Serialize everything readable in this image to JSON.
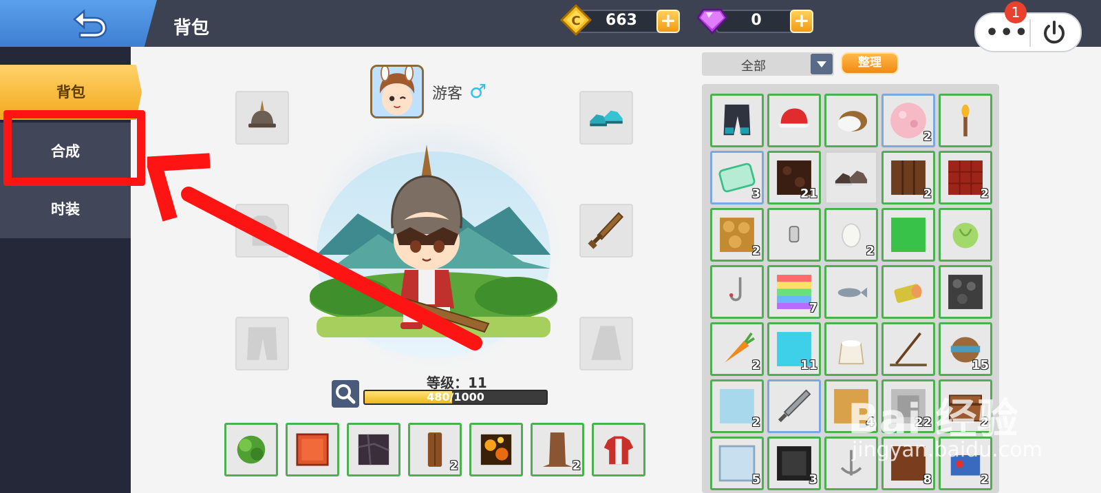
{
  "header": {
    "title": "背包",
    "coins": "663",
    "gems": "0",
    "notification_count": "1",
    "menu_label": "•••"
  },
  "sidebar": {
    "items": [
      {
        "label": "背包"
      },
      {
        "label": "合成"
      },
      {
        "label": "时装"
      }
    ]
  },
  "player": {
    "name": "游客",
    "gender_symbol": "♂",
    "level_text": "等级：11",
    "xp_text": "480/1000",
    "xp_fraction": 0.48
  },
  "inventory": {
    "filter_label": "全部",
    "sort_label": "整理"
  },
  "hotbar": [
    {
      "icon": "leaf-block-icon",
      "count": ""
    },
    {
      "icon": "red-brick-icon",
      "count": ""
    },
    {
      "icon": "dark-stone-icon",
      "count": ""
    },
    {
      "icon": "log-icon",
      "count": "2"
    },
    {
      "icon": "lava-block-icon",
      "count": ""
    },
    {
      "icon": "tree-trunk-icon",
      "count": "2"
    },
    {
      "icon": "red-shirt-icon",
      "count": ""
    }
  ],
  "inventory_items": [
    {
      "icon": "pants-icon",
      "count": ""
    },
    {
      "icon": "red-cap-icon",
      "count": ""
    },
    {
      "icon": "coconut-icon",
      "count": ""
    },
    {
      "icon": "pink-flower-block-icon",
      "count": "2"
    },
    {
      "icon": "torch-icon",
      "count": ""
    },
    {
      "icon": "ticket-icon",
      "count": "3"
    },
    {
      "icon": "dark-soil-icon",
      "count": "21"
    },
    {
      "icon": "shoes-icon",
      "count": ""
    },
    {
      "icon": "wood-plank-icon",
      "count": "2"
    },
    {
      "icon": "red-pattern-block-icon",
      "count": "2"
    },
    {
      "icon": "sandstone-icon",
      "count": "2"
    },
    {
      "icon": "lamp-icon",
      "count": ""
    },
    {
      "icon": "egg-icon",
      "count": "2"
    },
    {
      "icon": "grass-block-icon",
      "count": ""
    },
    {
      "icon": "cabbage-icon",
      "count": ""
    },
    {
      "icon": "fish-hook-icon",
      "count": ""
    },
    {
      "icon": "rainbow-block-icon",
      "count": "7"
    },
    {
      "icon": "fish-icon",
      "count": ""
    },
    {
      "icon": "log-slice-icon",
      "count": ""
    },
    {
      "icon": "gravel-icon",
      "count": ""
    },
    {
      "icon": "carrot-icon",
      "count": "2"
    },
    {
      "icon": "water-block-icon",
      "count": "11"
    },
    {
      "icon": "flour-sack-icon",
      "count": ""
    },
    {
      "icon": "fishing-rod-icon",
      "count": ""
    },
    {
      "icon": "barrel-icon",
      "count": "15"
    },
    {
      "icon": "ice-block-icon",
      "count": "2"
    },
    {
      "icon": "dagger-icon",
      "count": ""
    },
    {
      "icon": "sand-block-icon",
      "count": "4"
    },
    {
      "icon": "stone-slab-icon",
      "count": "22"
    },
    {
      "icon": "chest-icon",
      "count": "2"
    },
    {
      "icon": "glass-block-icon",
      "count": "5"
    },
    {
      "icon": "obsidian-icon",
      "count": "3"
    },
    {
      "icon": "anchor-icon",
      "count": ""
    },
    {
      "icon": "wood-block-icon",
      "count": "8"
    },
    {
      "icon": "toolkit-icon",
      "count": "2"
    }
  ],
  "watermark": {
    "text": "Bai 经验",
    "sub": "jingyan.baidu.com"
  }
}
